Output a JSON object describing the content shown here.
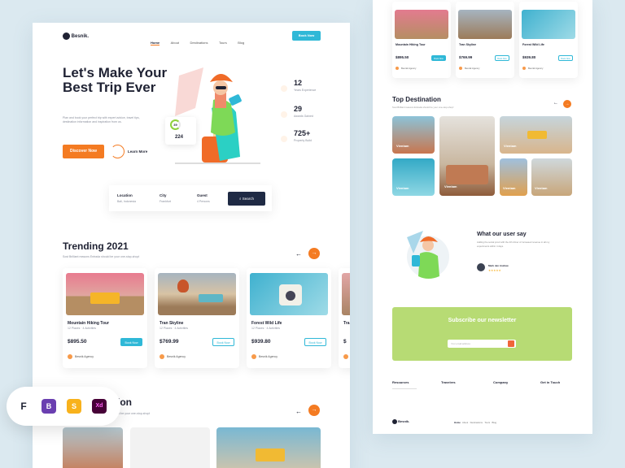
{
  "left": {
    "brand": "Besnik.",
    "nav": [
      "Home",
      "About",
      "Destinations",
      "Tours",
      "Blog"
    ],
    "book_now": "Book Now",
    "hero": {
      "title": "Let's Make Your Best Trip Ever",
      "desc": "Plan and book your perfect trip with expert advice, travel tips, destination information and inspiration from us.",
      "discover": "Discover Now",
      "learn": "Learn More",
      "ring_value": "39",
      "count_value": "224"
    },
    "stats": [
      {
        "value": "12",
        "label": "Years Experience"
      },
      {
        "value": "29",
        "label": "Awards Gained"
      },
      {
        "value": "725+",
        "label": "Property Build"
      }
    ],
    "search": {
      "location_label": "Location",
      "location_value": "Bali, Indonesia",
      "city_label": "City",
      "city_value": "Frankfurt",
      "guest_label": "Guest",
      "guest_value": "4 Persons",
      "button": "Search"
    },
    "trending": {
      "title": "Trending 2021",
      "desc": "Sost Brilliant reasons Entrada should be your one-stop-shop!",
      "cards": [
        {
          "name": "Mountain Hiking Tour",
          "meta": "12 Places · 4 Activities",
          "price": "$895.50",
          "book": "Book Now",
          "agency": "Besnik Agency"
        },
        {
          "name": "Tran Skyline",
          "meta": "12 Places · 4 Activities",
          "price": "$769.99",
          "book": "Book Now",
          "agency": "Besnik Agency"
        },
        {
          "name": "Forest Wild Life",
          "meta": "12 Places · 4 Activities",
          "price": "$939.80",
          "book": "Book Now",
          "agency": "Besnik Agency"
        },
        {
          "name": "Tra",
          "price": "$",
          "agency": "Be"
        }
      ]
    },
    "second": {
      "title": "tion",
      "desc": "lould be your one-stop-shop!"
    }
  },
  "tools": [
    "F",
    "B",
    "S",
    "Xd"
  ],
  "right": {
    "top_cards": [
      {
        "name": "Mountain Hiking Tour",
        "price": "$895.50",
        "book": "Book Now",
        "agency": "Besnik Agency"
      },
      {
        "name": "Tran Skyline",
        "price": "$769.99",
        "book": "Book Now",
        "agency": "Besnik Agency"
      },
      {
        "name": "Forest Wild Life",
        "price": "$939.80",
        "book": "Book Now",
        "agency": "Besnik Agency"
      }
    ],
    "dest_title": "Top Destination",
    "dest_desc": "Sost Brilliant reasons Entrada should be your one-stop-shop!",
    "destinations": [
      {
        "name": "Vientam"
      },
      {
        "name": "Vientam"
      },
      {
        "name": "Vientam"
      },
      {
        "name": "Vientam"
      },
      {
        "name": "Vientam"
      },
      {
        "name": "Vientam"
      }
    ],
    "user_title": "What our user say",
    "user_quote": "Adding the social proof with the 4th driver of increased revenue in all my experiments within 4 days.",
    "user_name": "Mark Jan Andrew",
    "news_title": "Subscribe our newsletter",
    "news_placeholder": "Your email address",
    "footer_cols": [
      "Resources",
      "Travelers",
      "Company",
      "Get in Touch"
    ],
    "footer_brand": "Besnik.",
    "footer_nav": [
      "Home",
      "About",
      "Destinations",
      "Tours",
      "Blog"
    ]
  },
  "colors": {
    "accent": "#f47b22",
    "teal": "#2fb8d7",
    "dark": "#1f2233",
    "green": "#b7db74"
  }
}
